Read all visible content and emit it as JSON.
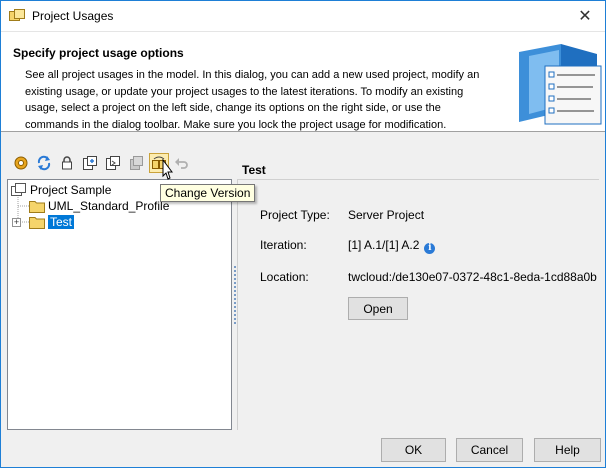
{
  "window": {
    "title": "Project Usages",
    "close_glyph": "✕"
  },
  "banner": {
    "heading": "Specify project usage options",
    "description": "See all project usages in the model. In this dialog, you can add a new used project, modify an existing usage, or update your project usages to the latest iterations. To modify an existing usage, select a project on the left side, change its options on the right side, or use the commands in the dialog toolbar. Make sure you lock the project usage for modification."
  },
  "toolbar": {
    "buttons": [
      {
        "icon": "options-gear-icon"
      },
      {
        "icon": "refresh-icon"
      },
      {
        "icon": "lock-icon"
      },
      {
        "icon": "add-used-project-icon"
      },
      {
        "icon": "import-project-icon"
      },
      {
        "icon": "remove-usage-icon"
      },
      {
        "icon": "change-version-icon"
      },
      {
        "icon": "undo-icon"
      }
    ],
    "tooltip": "Change Version"
  },
  "tree": {
    "root": "Project Sample",
    "children": [
      "UML_Standard_Profile",
      "Test"
    ],
    "selected": "Test",
    "expander_glyph": "+"
  },
  "details": {
    "title": "Test",
    "project_type_label": "Project Type:",
    "project_type_value": "Server Project",
    "iteration_label": "Iteration:",
    "iteration_value": "[1] A.1/[1] A.2",
    "info_glyph": "i",
    "location_label": "Location:",
    "location_value": "twcloud:/de130e07-0372-48c1-8eda-1cd88a0b",
    "open_label": "Open"
  },
  "footer": {
    "ok_label": "OK",
    "cancel_label": "Cancel",
    "help_label": "Help"
  },
  "colors": {
    "selection": "#0078d7",
    "tooltip_bg": "#ffffe1",
    "info": "#2a7ad6",
    "folder": "#f5d46b"
  }
}
